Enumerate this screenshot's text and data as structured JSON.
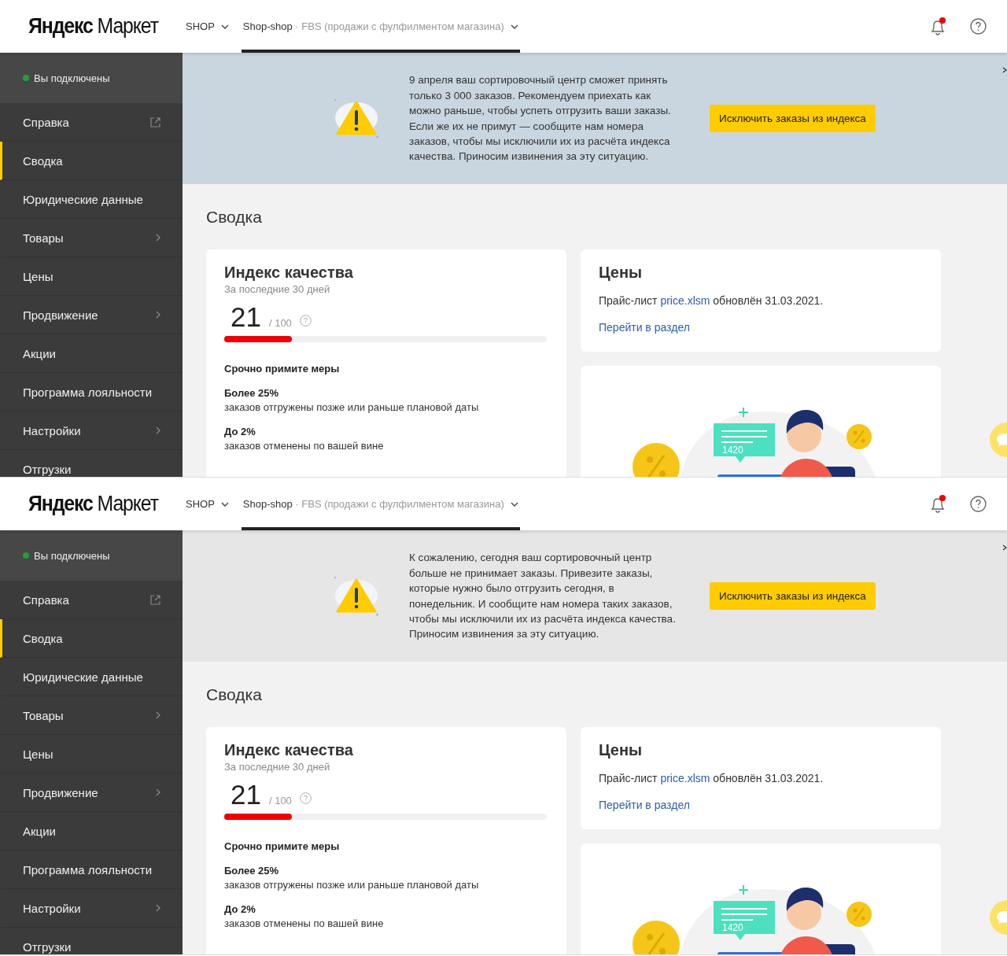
{
  "panels": [
    {
      "header": {
        "logo": "**Яндекс** Маркет",
        "tabs": [
          {
            "label": "SHOP",
            "selected": false
          },
          {
            "label": "Shop-shop",
            "detail": "· FBS (продажи с фулфилментом магазина)",
            "selected": true
          }
        ],
        "notification": true
      },
      "sidebar": {
        "status": {
          "label": "Вы подключены",
          "color": "#21a038"
        },
        "items": [
          {
            "label": "Справка",
            "kind": "external",
            "selected": false
          },
          {
            "label": "Сводка",
            "kind": "plain",
            "selected": true
          },
          {
            "label": "Юридические данные",
            "kind": "plain",
            "selected": false
          },
          {
            "label": "Товары",
            "kind": "submenu",
            "selected": false
          },
          {
            "label": "Цены",
            "kind": "plain",
            "selected": false
          },
          {
            "label": "Продвижение",
            "kind": "submenu",
            "selected": false
          },
          {
            "label": "Акции",
            "kind": "plain",
            "selected": false
          },
          {
            "label": "Программа лояльности",
            "kind": "plain",
            "selected": false
          },
          {
            "label": "Настройки",
            "kind": "submenu",
            "selected": false
          },
          {
            "label": "Отгрузки",
            "kind": "plain",
            "selected": false
          }
        ]
      },
      "banner": {
        "color": "#c9d6e0",
        "text": "9 апреля ваш сортировочный центр сможет принять только 3 000 заказов. Рекомендуем приехать как можно раньше, чтобы успеть отгрузить ваши заказы. Если же их не примут — сообщите нам номера заказов, чтобы мы исключили их из расчёта индекса качества. Приносим извинения за эту ситуацию.",
        "button": "Исключить заказы из индекса"
      },
      "title": "Сводка",
      "quality": {
        "title": "Индекс качества",
        "subtitle": "За последние 30 дней",
        "score": "21",
        "max": "/ 100",
        "level": 0.21,
        "alert": "Срочно примите меры",
        "items": [
          {
            "value": "Более 25%",
            "text": "заказов отгружены позже или раньше плановой даты"
          },
          {
            "value": "До 2%",
            "text": "заказов отменены по вашей вине"
          }
        ]
      },
      "prices": {
        "title": "Цены",
        "before": "Прайс-лист ",
        "file": "price.xlsm",
        "after": " обновлён 31.03.2021.",
        "link": "Перейти в раздел"
      },
      "illustration": {
        "number": "1420"
      }
    },
    {
      "header": {
        "logo": "**Яндекс** Маркет",
        "tabs": [
          {
            "label": "SHOP",
            "selected": false
          },
          {
            "label": "Shop-shop",
            "detail": "· FBS (продажи с фулфилментом магазина)",
            "selected": true
          }
        ],
        "notification": true
      },
      "sidebar": {
        "status": {
          "label": "Вы подключены",
          "color": "#21a038"
        },
        "items": [
          {
            "label": "Справка",
            "kind": "external",
            "selected": false
          },
          {
            "label": "Сводка",
            "kind": "plain",
            "selected": true
          },
          {
            "label": "Юридические данные",
            "kind": "plain",
            "selected": false
          },
          {
            "label": "Товары",
            "kind": "submenu",
            "selected": false
          },
          {
            "label": "Цены",
            "kind": "plain",
            "selected": false
          },
          {
            "label": "Продвижение",
            "kind": "submenu",
            "selected": false
          },
          {
            "label": "Акции",
            "kind": "plain",
            "selected": false
          },
          {
            "label": "Программа лояльности",
            "kind": "plain",
            "selected": false
          },
          {
            "label": "Настройки",
            "kind": "submenu",
            "selected": false
          },
          {
            "label": "Отгрузки",
            "kind": "plain",
            "selected": false
          }
        ]
      },
      "banner": {
        "color": "#e6e6e6",
        "text": "К сожалению, сегодня ваш сортировочный центр больше не принимает заказы. Привезите заказы, которые нужно было отгрузить сегодня, в понедельник. И сообщите нам номера таких заказов, чтобы мы исключили их из расчёта индекса качества. Приносим извинения за эту ситуацию.",
        "button": "Исключить заказы из индекса"
      },
      "title": "Сводка",
      "quality": {
        "title": "Индекс качества",
        "subtitle": "За последние 30 дней",
        "score": "21",
        "max": "/ 100",
        "level": 0.21,
        "alert": "Срочно примите меры",
        "items": [
          {
            "value": "Более 25%",
            "text": "заказов отгружены позже или раньше плановой даты"
          },
          {
            "value": "До 2%",
            "text": "заказов отменены по вашей вине"
          }
        ]
      },
      "prices": {
        "title": "Цены",
        "before": "Прайс-лист ",
        "file": "price.xlsm",
        "after": " обновлён 31.03.2021.",
        "link": "Перейти в раздел"
      },
      "illustration": {
        "number": "1420"
      }
    }
  ]
}
